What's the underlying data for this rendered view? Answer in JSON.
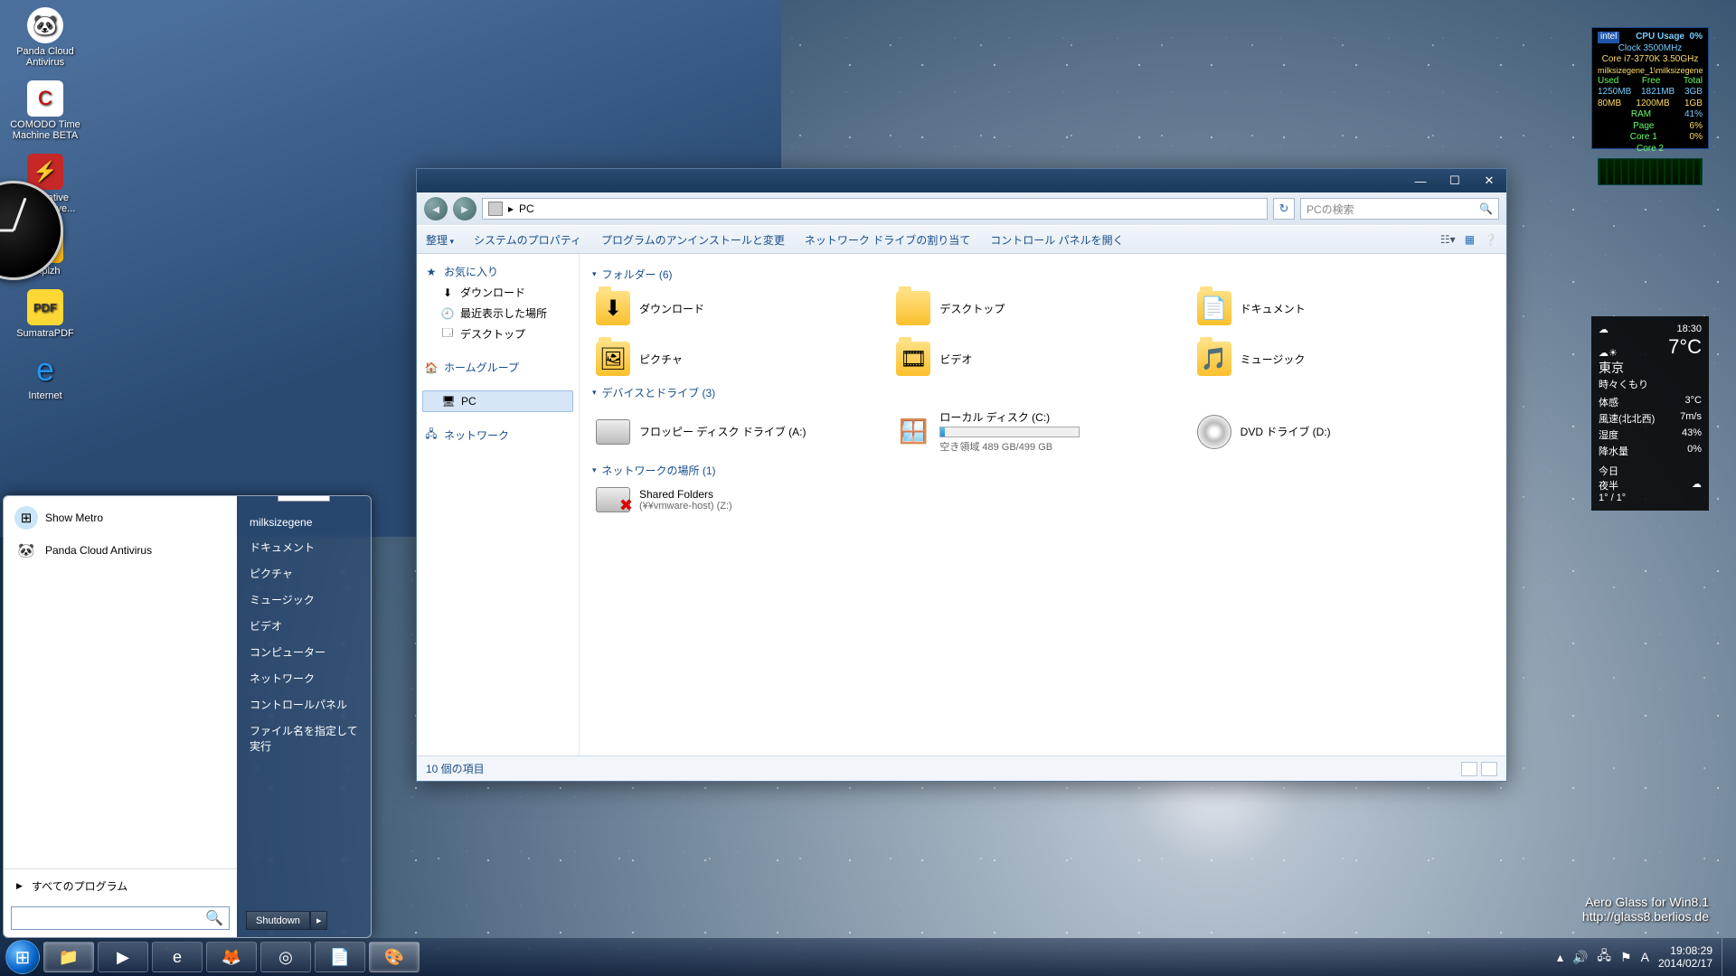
{
  "desktop_icons": [
    {
      "label": "Panda Cloud\nAntivirus",
      "glyph": "🐼",
      "cls": "panda"
    },
    {
      "label": "COMODO Time\nMachine BETA",
      "glyph": "C",
      "cls": "comodo"
    },
    {
      "label": "Alternative\nFlash Playe...",
      "glyph": "⚡",
      "cls": "flash"
    },
    {
      "label": "Explzh",
      "glyph": "📦",
      "cls": "zip"
    },
    {
      "label": "SumatraPDF",
      "glyph": "PDF",
      "cls": "pdf"
    },
    {
      "label": "Internet",
      "glyph": "e",
      "cls": "ie"
    }
  ],
  "startmenu": {
    "apps": [
      {
        "label": "Show Metro",
        "icon": "⊞",
        "bg": "#c9e6f9"
      },
      {
        "label": "Panda Cloud Antivirus",
        "icon": "🐼",
        "bg": "#fff"
      }
    ],
    "all_programs": "すべてのプログラム",
    "search_placeholder": "",
    "user": "milksizegene",
    "links": [
      "ドキュメント",
      "ピクチャ",
      "ミュージック",
      "ビデオ",
      "コンピューター",
      "ネットワーク",
      "コントロールパネル",
      "ファイル名を指定して実行"
    ],
    "shutdown": "Shutdown"
  },
  "explorer": {
    "breadcrumb": "PC",
    "search_placeholder": "PCの検索",
    "toolbar": {
      "organize": "整理",
      "items": [
        "システムのプロパティ",
        "プログラムのアンインストールと変更",
        "ネットワーク ドライブの割り当て",
        "コントロール パネルを開く"
      ]
    },
    "sidebar": {
      "fav_header": "お気に入り",
      "fav": [
        {
          "i": "⬇",
          "t": "ダウンロード"
        },
        {
          "i": "🕘",
          "t": "最近表示した場所"
        },
        {
          "i": "🗔",
          "t": "デスクトップ"
        }
      ],
      "homegroup": "ホームグループ",
      "pc": "PC",
      "network": "ネットワーク"
    },
    "sections": {
      "folders": {
        "title": "フォルダー (6)",
        "items": [
          {
            "name": "ダウンロード"
          },
          {
            "name": "デスクトップ"
          },
          {
            "name": "ドキュメント"
          },
          {
            "name": "ピクチャ"
          },
          {
            "name": "ビデオ"
          },
          {
            "name": "ミュージック"
          }
        ]
      },
      "drives": {
        "title": "デバイスとドライブ (3)",
        "items": [
          {
            "name": "フロッピー ディスク ドライブ (A:)",
            "type": "floppy"
          },
          {
            "name": "ローカル ディスク (C:)",
            "type": "hdd",
            "sub": "空き領域 489 GB/499 GB"
          },
          {
            "name": "DVD ドライブ (D:)",
            "type": "dvd"
          }
        ]
      },
      "network": {
        "title": "ネットワークの場所 (1)",
        "items": [
          {
            "name": "Shared Folders",
            "sub": "(¥¥vmware-host) (Z:)",
            "type": "nerr"
          }
        ]
      }
    },
    "status": "10 個の項目"
  },
  "cpu_gadget": {
    "title": "CPU Usage",
    "pct": "0%",
    "clock": "Clock 3500MHz",
    "cpu": "Core i7-3770K 3.50GHz",
    "user": "milksizegene_1\\milksizegene",
    "cols": [
      "Used",
      "Free",
      "Total"
    ],
    "mem": [
      "1250MB",
      "1821MB",
      "3GB"
    ],
    "swap": [
      "80MB",
      "1200MB",
      "1GB"
    ],
    "ram_label": "RAM",
    "ram_pct": "41%",
    "page_label": "Page",
    "page_pct": "6%",
    "core1": "Core 1",
    "core1_pct": "0%",
    "core2": "Core 2",
    "core2_pct": ""
  },
  "weather": {
    "time": "18:30",
    "temp": "7°C",
    "city": "東京",
    "cond": "時々くもり",
    "lines": [
      [
        "体感",
        "3°C"
      ],
      [
        "風速(北北西)",
        "7m/s"
      ],
      [
        "湿度",
        "43%"
      ],
      [
        "降水量",
        "0%"
      ]
    ],
    "today": "今日",
    "tonight": "夜半",
    "range": "1° / 1°"
  },
  "watermark": {
    "l1": "Aero Glass for Win8.1",
    "l2": "http://glass8.berlios.de"
  },
  "taskbar": {
    "buttons": [
      {
        "name": "explorer",
        "glyph": "📁",
        "active": true
      },
      {
        "name": "wmp",
        "glyph": "▶",
        "active": false
      },
      {
        "name": "ie",
        "glyph": "e",
        "active": false
      },
      {
        "name": "firefox",
        "glyph": "🦊",
        "active": false
      },
      {
        "name": "chrome",
        "glyph": "◎",
        "active": false
      },
      {
        "name": "notepad",
        "glyph": "📄",
        "active": false
      },
      {
        "name": "paint",
        "glyph": "🎨",
        "active": true
      }
    ],
    "ime": "A",
    "time": "19:08:29",
    "date": "2014/02/17"
  }
}
